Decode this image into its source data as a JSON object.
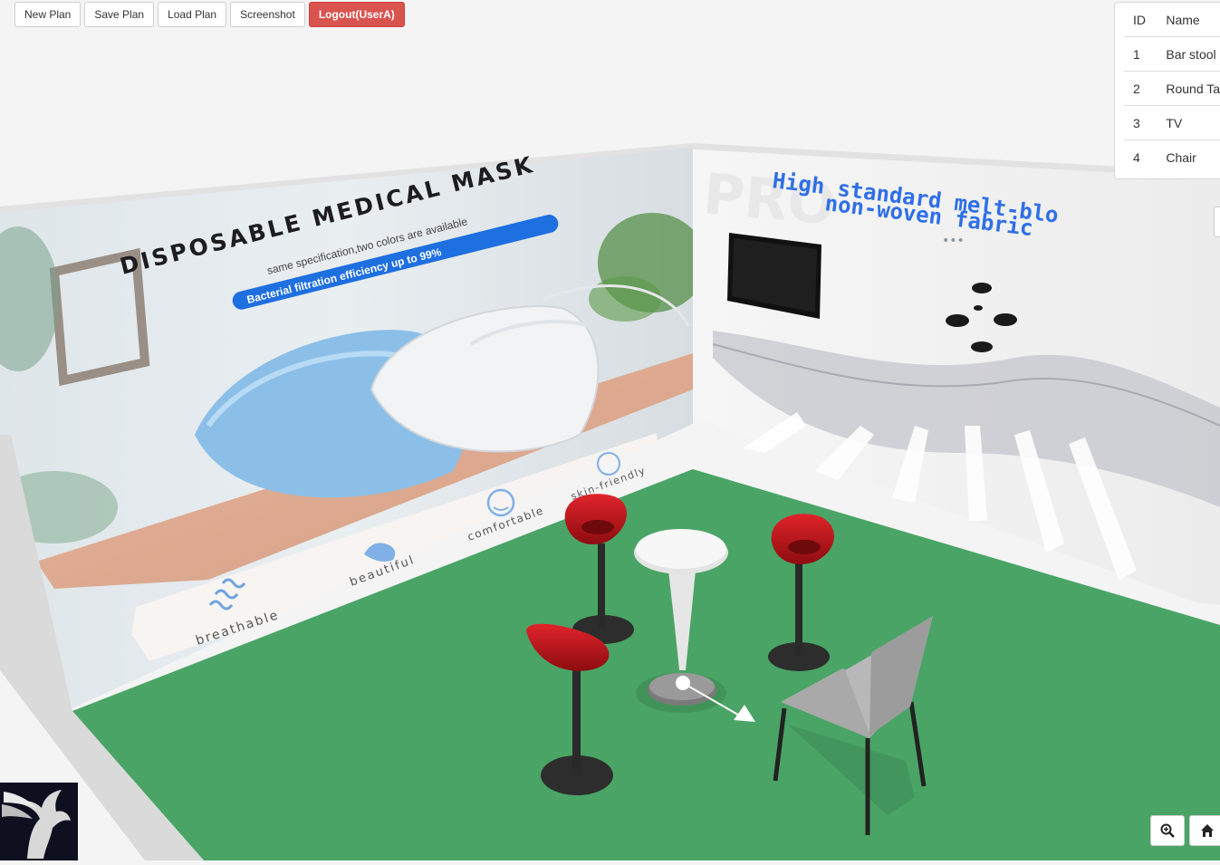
{
  "toolbar": {
    "new_plan": "New Plan",
    "save_plan": "Save Plan",
    "load_plan": "Load Plan",
    "screenshot": "Screenshot",
    "logout": "Logout(UserA)"
  },
  "item_table": {
    "headers": [
      "ID",
      "Name"
    ],
    "rows": [
      {
        "id": "1",
        "name": "Bar stool"
      },
      {
        "id": "2",
        "name": "Round Tab"
      },
      {
        "id": "3",
        "name": "TV"
      },
      {
        "id": "4",
        "name": "Chair"
      }
    ]
  },
  "left_wall": {
    "title": "DISPOSABLE MEDICAL MASK",
    "subtitle": "same specification,two colors are available",
    "badge": "Bacterial filtration efficiency up to 99%",
    "features": [
      "breathable",
      "beautiful",
      "comfortable",
      "skin-friendly"
    ]
  },
  "right_wall": {
    "watermark": "PRO",
    "line1": "High standard melt-blo",
    "line2": "non-woven fabric",
    "dots": "•••"
  },
  "colors": {
    "floor": "#4aa466",
    "danger": "#d9534f",
    "banner_blue": "#1e6fe0",
    "headline_blue": "#2f6fe6",
    "stool_red": "#c0141b"
  },
  "icons": {
    "zoom": "zoom-in-icon",
    "home": "home-icon",
    "logo": "pegasus-logo"
  }
}
